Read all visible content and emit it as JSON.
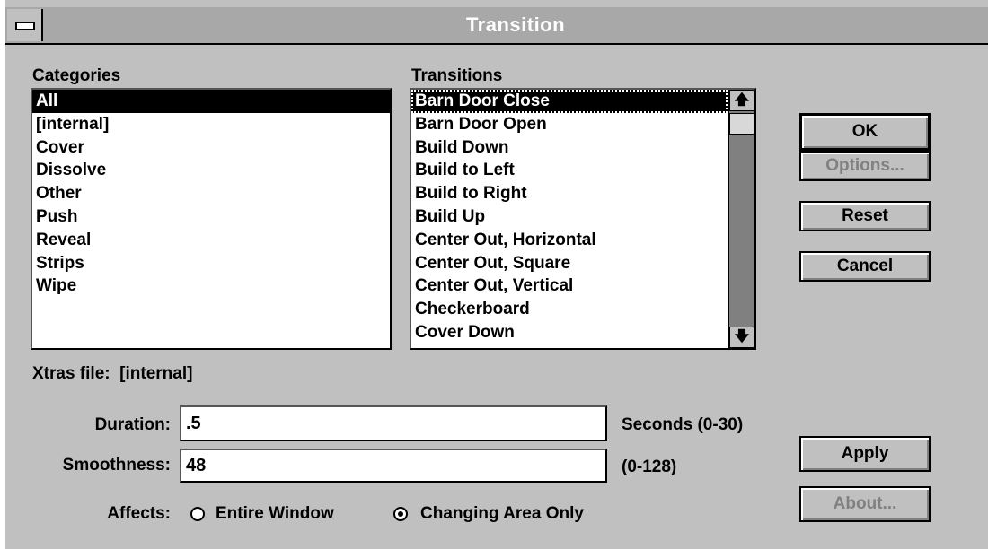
{
  "window": {
    "title": "Transition"
  },
  "categories": {
    "label": "Categories",
    "items": [
      "All",
      "[internal]",
      "Cover",
      "Dissolve",
      "Other",
      "Push",
      "Reveal",
      "Strips",
      "Wipe"
    ],
    "selected_index": 0
  },
  "transitions": {
    "label": "Transitions",
    "items": [
      "Barn Door Close",
      "Barn Door Open",
      "Build Down",
      "Build to Left",
      "Build to Right",
      "Build Up",
      "Center Out, Horizontal",
      "Center Out, Square",
      "Center Out, Vertical",
      "Checkerboard",
      "Cover Down"
    ],
    "selected_index": 0
  },
  "buttons": {
    "ok": "OK",
    "options": "Options...",
    "reset": "Reset",
    "cancel": "Cancel",
    "apply": "Apply",
    "about": "About..."
  },
  "xtras": {
    "label": "Xtras file:",
    "value": "[internal]"
  },
  "duration": {
    "label": "Duration:",
    "value": ".5",
    "unit": "Seconds (0-30)"
  },
  "smoothness": {
    "label": "Smoothness:",
    "value": "48",
    "unit": "(0-128)"
  },
  "affects": {
    "label": "Affects:",
    "options": [
      "Entire Window",
      "Changing Area Only"
    ],
    "selected": "Changing Area Only"
  }
}
